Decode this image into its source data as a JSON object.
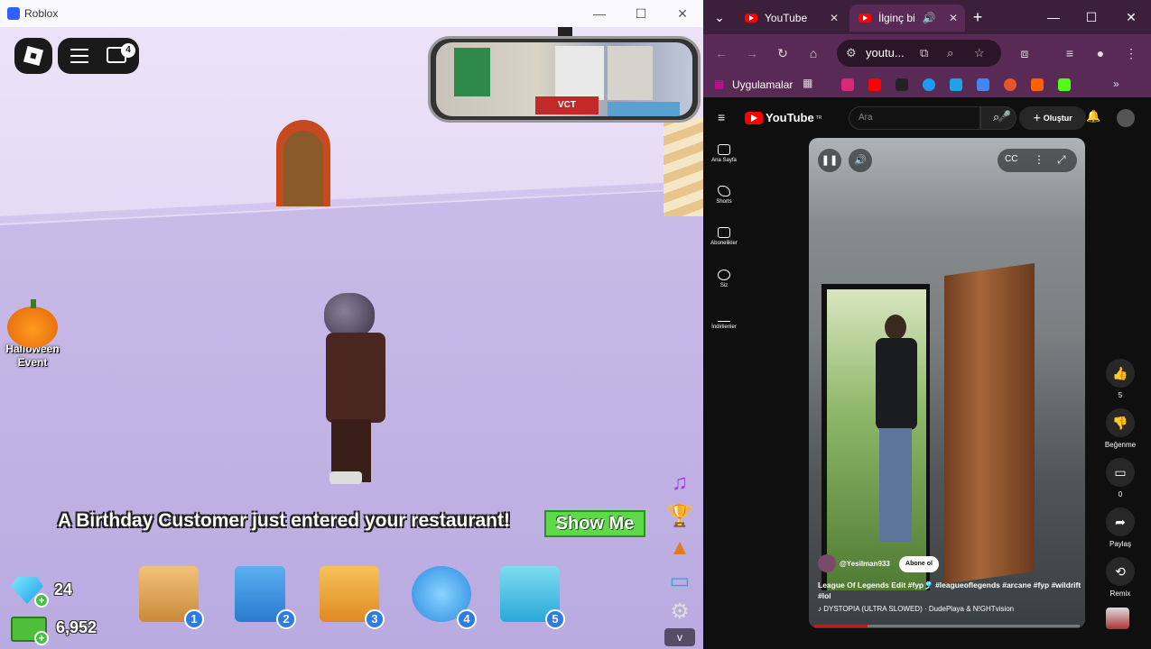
{
  "roblox": {
    "window_title": "Roblox",
    "chat_badge": "4",
    "halloween_line1": "Halloween",
    "halloween_line2": "Event",
    "banner": "A Birthday Customer just entered your restaurant!",
    "show_me": "Show Me",
    "gems": "24",
    "cash": "6,952",
    "hotbar": [
      "1",
      "2",
      "3",
      "4",
      "5"
    ],
    "v_button": "v",
    "mirror_poster_text": "VCT"
  },
  "browser": {
    "tabs": [
      {
        "label": "YouTube",
        "active": false
      },
      {
        "label": "İlginç bi",
        "active": true
      }
    ],
    "url": "youtu...",
    "bookmarks_label": "Uygulamalar",
    "accent": "#5a2a56"
  },
  "youtube": {
    "logo": "YouTube",
    "logo_country": "TR",
    "search_placeholder": "Ara",
    "create_label": "Oluştur",
    "sidebar": [
      {
        "label": "Ana Sayfa",
        "icon": "home-icon"
      },
      {
        "label": "Shorts",
        "icon": "shorts-icon"
      },
      {
        "label": "Abonelikler",
        "icon": "subscriptions-icon"
      },
      {
        "label": "Siz",
        "icon": "you-icon"
      },
      {
        "label": "İndirilenler",
        "icon": "download-icon"
      }
    ],
    "video": {
      "channel": "@Yesilman933",
      "subscribe": "Abone ol",
      "title": "League Of Legends Edit #fyp🎐 #leagueoflegends #arcane #fyp #wildrift #lol",
      "music": "DYSTOPIA (ULTRA SLOWED) · DudePlaya & N!GHTvision",
      "progress": 0.2
    },
    "actions": [
      {
        "label": "5",
        "icon": "like-icon"
      },
      {
        "label": "Beğenme",
        "icon": "dislike-icon"
      },
      {
        "label": "0",
        "icon": "comment-icon"
      },
      {
        "label": "Paylaş",
        "icon": "share-icon"
      },
      {
        "label": "Remix",
        "icon": "remix-icon"
      }
    ]
  }
}
